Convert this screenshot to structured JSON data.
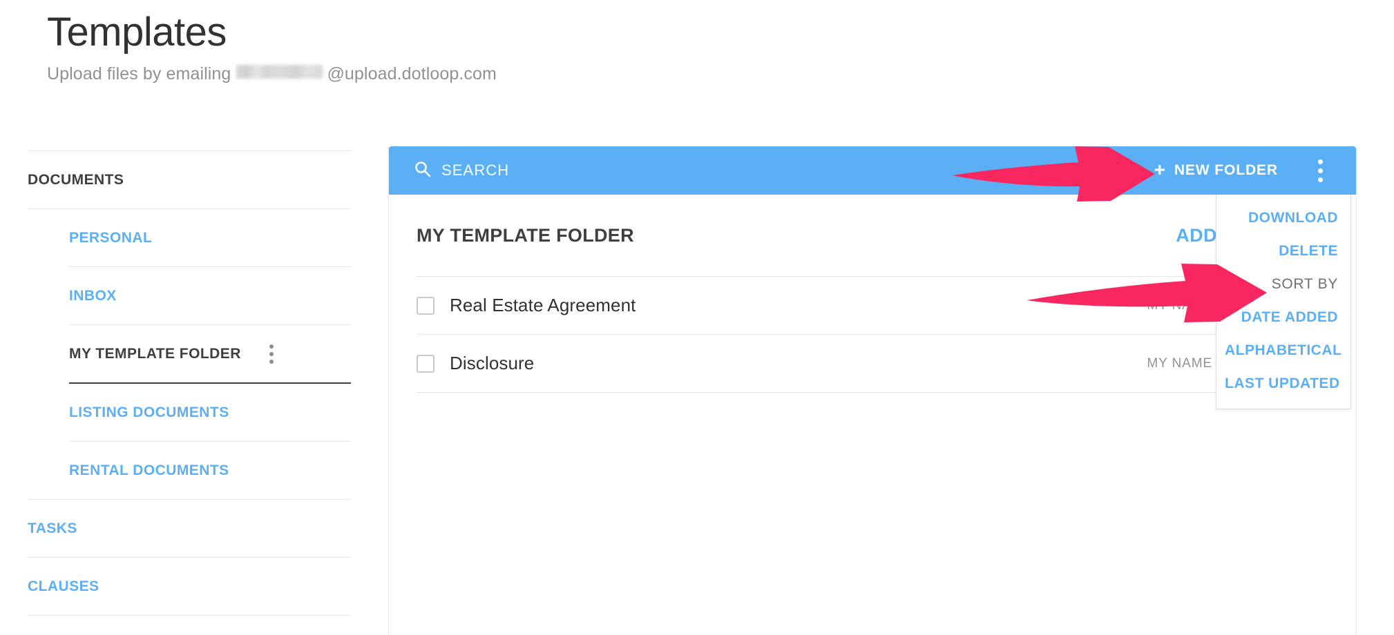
{
  "header": {
    "title": "Templates",
    "subtitle_prefix": "Upload files by emailing",
    "subtitle_suffix": "@upload.dotloop.com",
    "redacted": true
  },
  "sidebar": {
    "items": [
      {
        "label": "DOCUMENTS",
        "type": "section",
        "active": false,
        "indent": false,
        "kebab": false
      },
      {
        "label": "PERSONAL",
        "type": "link",
        "active": false,
        "indent": true,
        "kebab": false
      },
      {
        "label": "INBOX",
        "type": "link",
        "active": false,
        "indent": true,
        "kebab": false
      },
      {
        "label": "MY TEMPLATE FOLDER",
        "type": "link",
        "active": true,
        "indent": true,
        "kebab": true
      },
      {
        "label": "LISTING DOCUMENTS",
        "type": "link",
        "active": false,
        "indent": true,
        "kebab": false
      },
      {
        "label": "RENTAL DOCUMENTS",
        "type": "link",
        "active": false,
        "indent": true,
        "kebab": false
      },
      {
        "label": "TASKS",
        "type": "link",
        "active": false,
        "indent": false,
        "kebab": false
      },
      {
        "label": "CLAUSES",
        "type": "link",
        "active": false,
        "indent": false,
        "kebab": false
      }
    ]
  },
  "toolbar": {
    "search_placeholder": "SEARCH",
    "search_value": "",
    "new_folder_label": "NEW FOLDER",
    "plus_symbol": "+",
    "kebab_icon": "more-vertical-icon",
    "background_color": "#5bb0f5"
  },
  "folder": {
    "title": "MY TEMPLATE FOLDER",
    "add_doc_label": "ADD DOCUMENT",
    "documents": [
      {
        "name": "Real Estate Agreement",
        "owner": "MY NAME",
        "checked": false
      },
      {
        "name": "Disclosure",
        "owner": "MY NAME",
        "checked": false
      }
    ]
  },
  "dropdown": {
    "visible": true,
    "items": [
      {
        "label": "DOWNLOAD",
        "kind": "action"
      },
      {
        "label": "DELETE",
        "kind": "action"
      },
      {
        "label": "SORT BY",
        "kind": "header"
      },
      {
        "label": "DATE ADDED",
        "kind": "action"
      },
      {
        "label": "ALPHABETICAL",
        "kind": "action"
      },
      {
        "label": "LAST UPDATED",
        "kind": "action"
      }
    ]
  },
  "annotations": {
    "arrow_color": "#f8275f",
    "arrows": [
      {
        "name": "arrow-to-new-folder",
        "target": "new-folder-button"
      },
      {
        "name": "arrow-to-sort-by",
        "target": "dropdown-sort-by"
      }
    ]
  },
  "colors": {
    "accent_blue": "#5bb0f5",
    "text_dark": "#3c4043",
    "text_muted": "#8d9295",
    "rule": "#e6e7e8",
    "annotation_pink": "#f8275f"
  }
}
